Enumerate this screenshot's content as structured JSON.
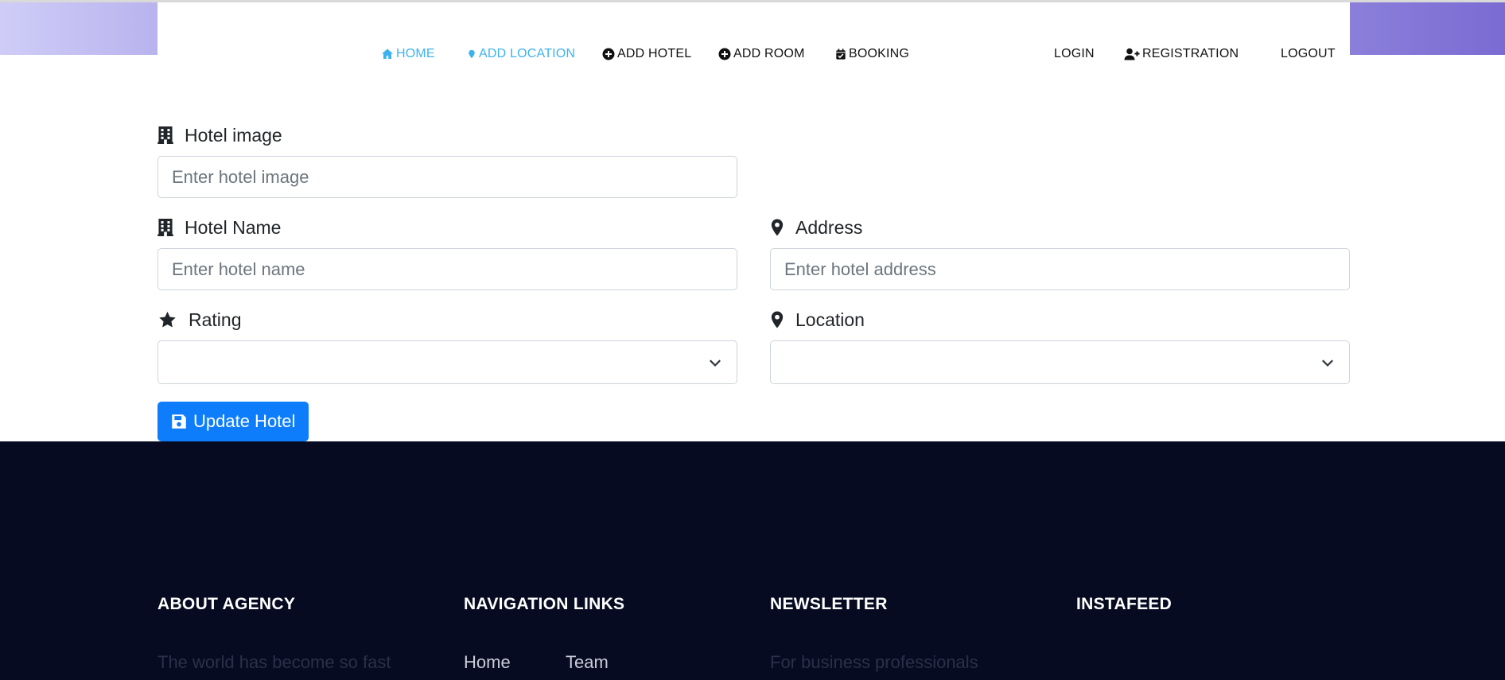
{
  "nav": {
    "items": [
      {
        "label": "HOME",
        "icon": "home-icon",
        "active": true
      },
      {
        "label": "ADD LOCATION",
        "icon": "map-marker-icon",
        "active": true
      },
      {
        "label": "ADD HOTEL",
        "icon": "plus-circle-icon",
        "active": false
      },
      {
        "label": "ADD ROOM",
        "icon": "plus-circle-icon",
        "active": false
      },
      {
        "label": "BOOKING",
        "icon": "calendar-check-icon",
        "active": false
      }
    ],
    "login": "LOGIN",
    "registration": "REGISTRATION",
    "logout": "LOGOUT"
  },
  "form": {
    "hotel_image": {
      "label": "Hotel image",
      "placeholder": "Enter hotel image",
      "value": "",
      "icon": "building-icon"
    },
    "hotel_name": {
      "label": "Hotel Name",
      "placeholder": "Enter hotel name",
      "value": "",
      "icon": "building-icon"
    },
    "address": {
      "label": "Address",
      "placeholder": "Enter hotel address",
      "value": "",
      "icon": "map-marker-icon"
    },
    "rating": {
      "label": "Rating",
      "selected": "",
      "icon": "star-icon"
    },
    "location": {
      "label": "Location",
      "selected": "",
      "icon": "map-marker-icon"
    },
    "submit_label": "Update Hotel",
    "submit_icon": "save-icon"
  },
  "footer": {
    "about": {
      "heading": "ABOUT AGENCY",
      "text": "The world has become so fast"
    },
    "navigation": {
      "heading": "NAVIGATION LINKS",
      "links": [
        "Home",
        "Team"
      ]
    },
    "newsletter": {
      "heading": "NEWSLETTER",
      "text": "For business professionals"
    },
    "instafeed": {
      "heading": "INSTAFEED"
    }
  },
  "colors": {
    "accent": "#3cb3ef",
    "button": "#0d7dfb",
    "footer_bg": "#060b21",
    "gradient_left": "#c4c0f3",
    "gradient_right": "#7a6bd3"
  }
}
